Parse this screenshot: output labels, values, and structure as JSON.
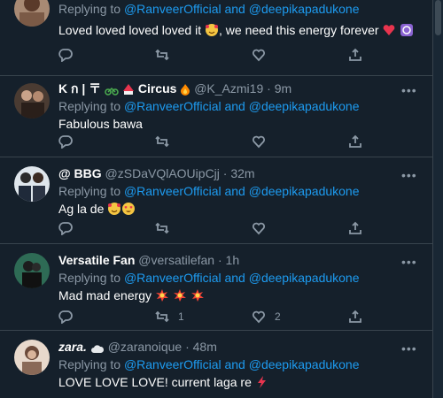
{
  "tweets": [
    {
      "name": "",
      "handle": "",
      "time": "",
      "replying_prefix": "Replying to",
      "replying_users": "@RanveerOfficial and @deepikapadukone",
      "text": "Loved loved loved loved it",
      "text_suffix": ", we need this energy forever",
      "replies": "",
      "retweets": "",
      "likes": ""
    },
    {
      "name": "K ก | 〒",
      "name_suffix": "Circus",
      "handle": "@K_Azmi19",
      "time": "· 9m",
      "replying_prefix": "Replying to",
      "replying_users": "@RanveerOfficial and @deepikapadukone",
      "text": "Fabulous bawa",
      "replies": "",
      "retweets": "",
      "likes": ""
    },
    {
      "name": "@ BBG",
      "handle": "@zSDaVQlAOUipCjj",
      "time": "· 32m",
      "replying_prefix": "Replying to",
      "replying_users": "@RanveerOfficial and @deepikapadukone",
      "text": "Ag la de",
      "replies": "",
      "retweets": "",
      "likes": ""
    },
    {
      "name": "Versatile Fan",
      "handle": "@versatilefan",
      "time": "· 1h",
      "replying_prefix": "Replying to",
      "replying_users": "@RanveerOfficial and @deepikapadukone",
      "text": "Mad mad energy",
      "replies": "",
      "retweets": "1",
      "likes": "2"
    },
    {
      "name": "zara.",
      "handle": "@zaranoique",
      "time": "· 48m",
      "replying_prefix": "Replying to",
      "replying_users": "@RanveerOfficial and @deepikapadukone",
      "text": "LOVE LOVE LOVE! current laga re",
      "replies": "",
      "retweets": "",
      "likes": ""
    }
  ],
  "icons": {
    "reply": "reply-icon",
    "retweet": "retweet-icon",
    "like": "heart-icon",
    "share": "share-icon",
    "more": "more-icon"
  },
  "colors": {
    "background": "#15202b",
    "link": "#1d9bf0",
    "muted": "#8b98a5",
    "divider": "#38444d"
  }
}
